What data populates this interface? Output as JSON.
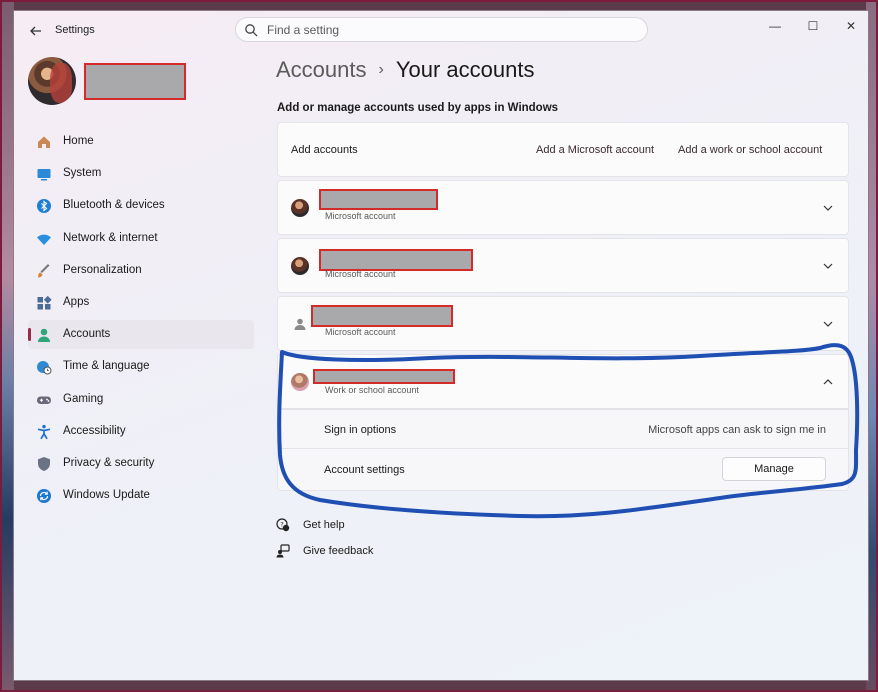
{
  "window": {
    "app_title": "Settings",
    "controls": {
      "minimize": "—",
      "maximize": "☐",
      "close": "✕"
    }
  },
  "search": {
    "placeholder": "Find a setting"
  },
  "profile": {
    "name_redacted": true
  },
  "sidebar": {
    "items": [
      {
        "label": "Home",
        "icon": "home-icon",
        "color": "#c98a52"
      },
      {
        "label": "System",
        "icon": "system-icon",
        "color": "#2b8ad8"
      },
      {
        "label": "Bluetooth & devices",
        "icon": "bluetooth-icon",
        "color": "#1f7fd6"
      },
      {
        "label": "Network & internet",
        "icon": "wifi-icon",
        "color": "#2a8fe0"
      },
      {
        "label": "Personalization",
        "icon": "brush-icon",
        "color": "#d8833a"
      },
      {
        "label": "Apps",
        "icon": "apps-icon",
        "color": "#4a6c96"
      },
      {
        "label": "Accounts",
        "icon": "accounts-icon",
        "color": "#2fa57a",
        "active": true
      },
      {
        "label": "Time & language",
        "icon": "globe-clock-icon",
        "color": "#2f8ad3"
      },
      {
        "label": "Gaming",
        "icon": "gamepad-icon",
        "color": "#6a6a7a"
      },
      {
        "label": "Accessibility",
        "icon": "accessibility-icon",
        "color": "#1d6fc9"
      },
      {
        "label": "Privacy & security",
        "icon": "shield-icon",
        "color": "#6a7284"
      },
      {
        "label": "Windows Update",
        "icon": "update-icon",
        "color": "#1f78d0"
      }
    ]
  },
  "main": {
    "breadcrumb": {
      "parent": "Accounts",
      "separator": "›",
      "current": "Your accounts"
    },
    "subheading": "Add or manage accounts used by apps in Windows",
    "add_row": {
      "label": "Add accounts",
      "add_microsoft": "Add a Microsoft account",
      "add_work": "Add a work or school account"
    },
    "accounts": [
      {
        "type": "Microsoft account",
        "expanded": false
      },
      {
        "type": "Microsoft account",
        "expanded": false
      },
      {
        "type": "Microsoft account",
        "expanded": false
      },
      {
        "type": "Work or school account",
        "expanded": true
      }
    ],
    "expanded_rows": {
      "sign_in_label": "Sign in options",
      "sign_in_value": "Microsoft apps can ask to sign me in",
      "settings_label": "Account settings",
      "manage_button": "Manage"
    }
  },
  "footer": {
    "get_help": "Get help",
    "give_feedback": "Give feedback"
  },
  "annotation_color": "#1f4fb3"
}
